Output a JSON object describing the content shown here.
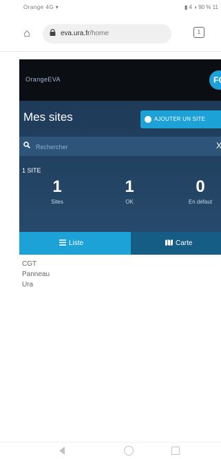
{
  "status_bar": {
    "left_text": "Orange 4G ▾",
    "right_text": "▮ 4 ◑ 90 % 11"
  },
  "browser": {
    "url_domain": "eva.ura.fr",
    "url_path": "/home",
    "tab_count": "1"
  },
  "app": {
    "logo_text": "OrangeEVA",
    "avatar_initials": "FC"
  },
  "page": {
    "title": "Mes sites",
    "add_button_label": "AJOUTER UN SITE",
    "search": {
      "placeholder": "Rechercher",
      "value": "",
      "clear_label": "X"
    },
    "site_count": "1 SITE",
    "stats": [
      {
        "value": "1",
        "label": "Sites"
      },
      {
        "value": "1",
        "label": "OK"
      },
      {
        "value": "0",
        "label": "En défaut"
      }
    ],
    "tabs": {
      "list": "Liste",
      "map": "Carte"
    },
    "list_items": [
      "CGT",
      "Panneau",
      "Ura"
    ]
  },
  "colors": {
    "accent": "#1da2d8",
    "header_bg": "#0b0f14",
    "panel_bg": "#1e3a58",
    "map_tab_bg": "#165d86"
  },
  "icons": {
    "home": "home-icon",
    "lock": "lock-icon",
    "search": "search-icon",
    "add": "plus-circle-icon",
    "list": "list-icon",
    "map": "map-icon"
  }
}
